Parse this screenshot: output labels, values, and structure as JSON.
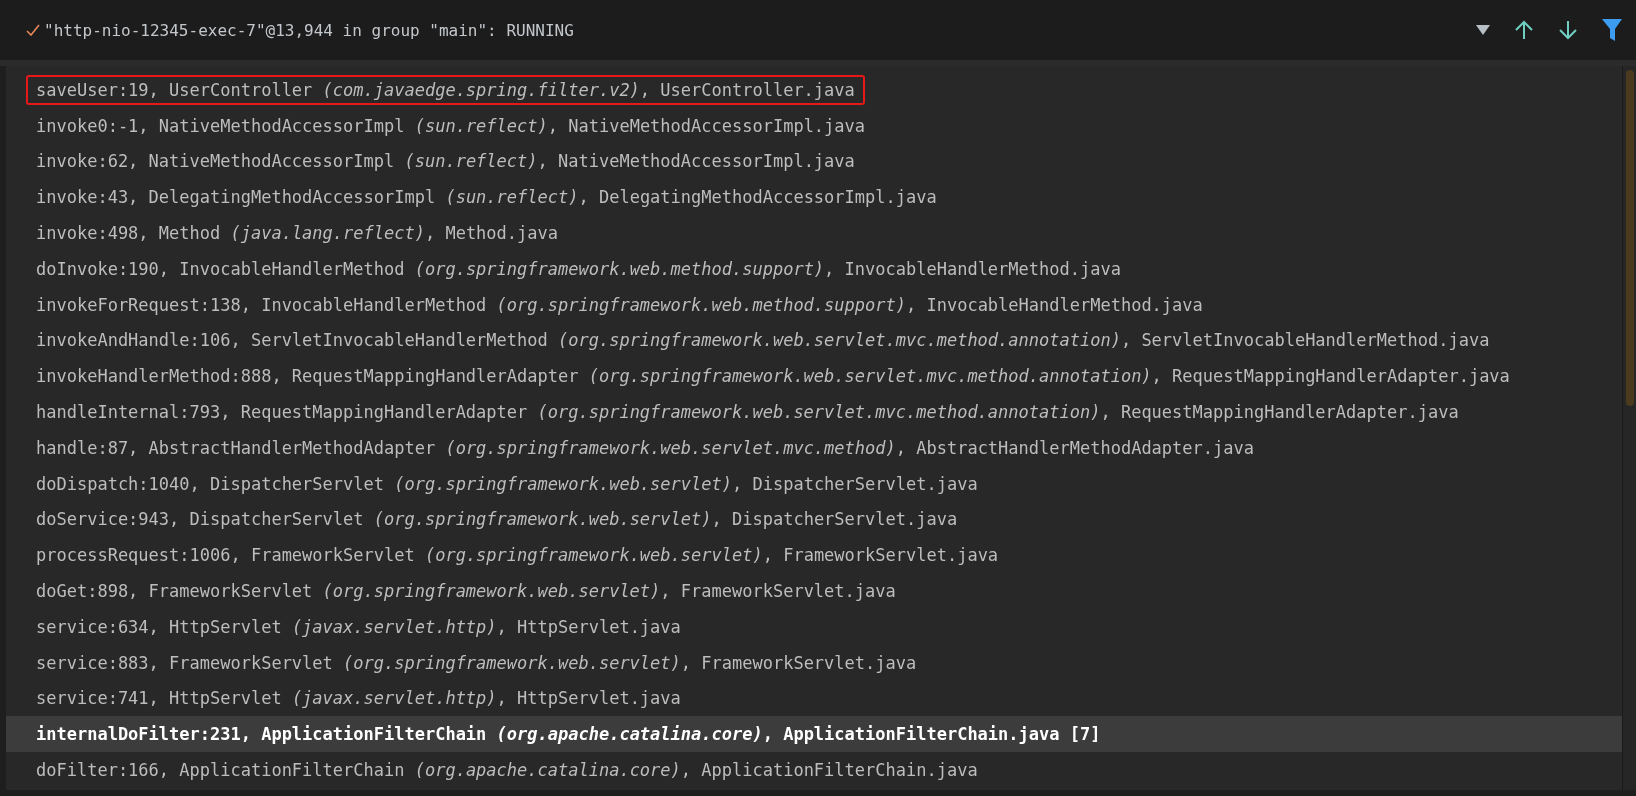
{
  "header": {
    "title": "\"http-nio-12345-exec-7\"@13,944 in group \"main\": RUNNING"
  },
  "frames": [
    {
      "text": "saveUser:19, UserController *(com.javaedge.spring.filter.v2)*, UserController.java",
      "selected": false,
      "outlined": true
    },
    {
      "text": "invoke0:-1, NativeMethodAccessorImpl *(sun.reflect)*, NativeMethodAccessorImpl.java",
      "selected": false,
      "outlined": false
    },
    {
      "text": "invoke:62, NativeMethodAccessorImpl *(sun.reflect)*, NativeMethodAccessorImpl.java",
      "selected": false,
      "outlined": false
    },
    {
      "text": "invoke:43, DelegatingMethodAccessorImpl *(sun.reflect)*, DelegatingMethodAccessorImpl.java",
      "selected": false,
      "outlined": false
    },
    {
      "text": "invoke:498, Method *(java.lang.reflect)*, Method.java",
      "selected": false,
      "outlined": false
    },
    {
      "text": "doInvoke:190, InvocableHandlerMethod *(org.springframework.web.method.support)*, InvocableHandlerMethod.java",
      "selected": false,
      "outlined": false
    },
    {
      "text": "invokeForRequest:138, InvocableHandlerMethod *(org.springframework.web.method.support)*, InvocableHandlerMethod.java",
      "selected": false,
      "outlined": false
    },
    {
      "text": "invokeAndHandle:106, ServletInvocableHandlerMethod *(org.springframework.web.servlet.mvc.method.annotation)*, ServletInvocableHandlerMethod.java",
      "selected": false,
      "outlined": false
    },
    {
      "text": "invokeHandlerMethod:888, RequestMappingHandlerAdapter *(org.springframework.web.servlet.mvc.method.annotation)*, RequestMappingHandlerAdapter.java",
      "selected": false,
      "outlined": false
    },
    {
      "text": "handleInternal:793, RequestMappingHandlerAdapter *(org.springframework.web.servlet.mvc.method.annotation)*, RequestMappingHandlerAdapter.java",
      "selected": false,
      "outlined": false
    },
    {
      "text": "handle:87, AbstractHandlerMethodAdapter *(org.springframework.web.servlet.mvc.method)*, AbstractHandlerMethodAdapter.java",
      "selected": false,
      "outlined": false
    },
    {
      "text": "doDispatch:1040, DispatcherServlet *(org.springframework.web.servlet)*, DispatcherServlet.java",
      "selected": false,
      "outlined": false
    },
    {
      "text": "doService:943, DispatcherServlet *(org.springframework.web.servlet)*, DispatcherServlet.java",
      "selected": false,
      "outlined": false
    },
    {
      "text": "processRequest:1006, FrameworkServlet *(org.springframework.web.servlet)*, FrameworkServlet.java",
      "selected": false,
      "outlined": false
    },
    {
      "text": "doGet:898, FrameworkServlet *(org.springframework.web.servlet)*, FrameworkServlet.java",
      "selected": false,
      "outlined": false
    },
    {
      "text": "service:634, HttpServlet *(javax.servlet.http)*, HttpServlet.java",
      "selected": false,
      "outlined": false
    },
    {
      "text": "service:883, FrameworkServlet *(org.springframework.web.servlet)*, FrameworkServlet.java",
      "selected": false,
      "outlined": false
    },
    {
      "text": "service:741, HttpServlet *(javax.servlet.http)*, HttpServlet.java",
      "selected": false,
      "outlined": false
    },
    {
      "text": "internalDoFilter:231, ApplicationFilterChain *(org.apache.catalina.core)*, ApplicationFilterChain.java [7]",
      "selected": true,
      "outlined": false
    },
    {
      "text": "doFilter:166, ApplicationFilterChain *(org.apache.catalina.core)*, ApplicationFilterChain.java",
      "selected": false,
      "outlined": false
    }
  ]
}
